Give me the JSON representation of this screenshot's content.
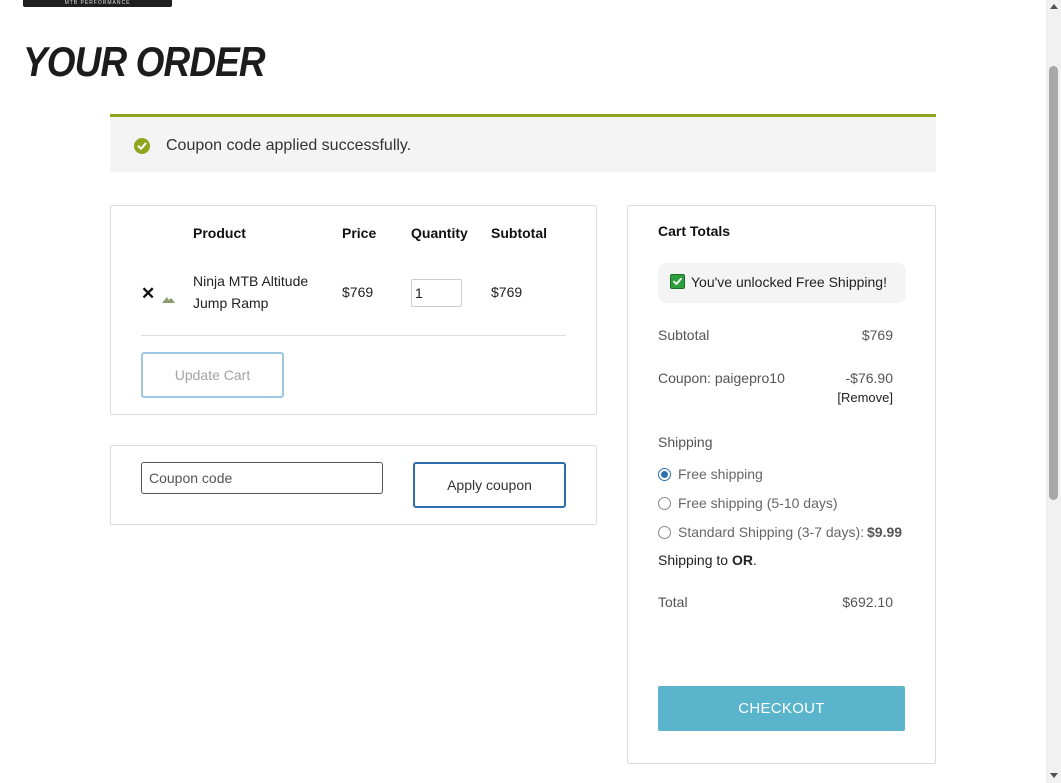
{
  "brand": {
    "logo_text": "MTB PERFORMANCE"
  },
  "page": {
    "title": "YOUR ORDER"
  },
  "notice": {
    "message": "Coupon code applied successfully.",
    "icon": "check-circle-icon",
    "accent_color": "#8fa51e"
  },
  "cart": {
    "headers": {
      "product": "Product",
      "price": "Price",
      "quantity": "Quantity",
      "subtotal": "Subtotal"
    },
    "items": [
      {
        "remove_symbol": "✕",
        "thumbnail_icon": "product-thumbnail",
        "name": "Ninja MTB Altitude Jump Ramp",
        "price": "$769",
        "quantity": "1",
        "subtotal": "$769"
      }
    ],
    "update_label": "Update Cart"
  },
  "coupon": {
    "placeholder": "Coupon code",
    "apply_label": "Apply coupon"
  },
  "totals": {
    "title": "Cart Totals",
    "free_shipping_banner": "You've unlocked Free Shipping!",
    "subtotal_label": "Subtotal",
    "subtotal_value": "$769",
    "coupon_label": "Coupon: paigepro10",
    "coupon_value": "-$76.90",
    "coupon_remove": "[Remove]",
    "shipping_label": "Shipping",
    "shipping_options": [
      {
        "label": "Free shipping",
        "price": "",
        "selected": true
      },
      {
        "label": "Free shipping (5-10 days)",
        "price": "",
        "selected": false
      },
      {
        "label": "Standard Shipping (3-7 days):",
        "price": "$9.99",
        "selected": false
      }
    ],
    "shipping_to_prefix": "Shipping to",
    "shipping_to_state": "OR",
    "shipping_to_suffix": ".",
    "total_label": "Total",
    "total_value": "$692.10",
    "checkout_label": "CHECKOUT",
    "checkout_color": "#5ab4cb"
  }
}
